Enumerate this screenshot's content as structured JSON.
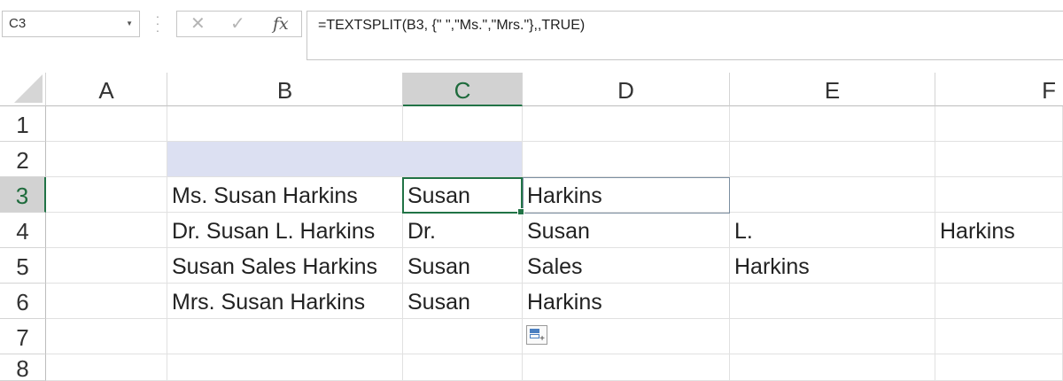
{
  "formula_bar": {
    "name_box": "C3",
    "cancel_glyph": "✕",
    "enter_glyph": "✓",
    "fx_glyph": "fx",
    "formula": "=TEXTSPLIT(B3, {\" \",\"Ms.\",\"Mrs.\"},,TRUE)"
  },
  "columns": [
    "A",
    "B",
    "C",
    "D",
    "E",
    "F"
  ],
  "rows": [
    "1",
    "2",
    "3",
    "4",
    "5",
    "6",
    "7",
    "8"
  ],
  "cells": {
    "B3": "Ms. Susan Harkins",
    "C3": "Susan",
    "D3": "Harkins",
    "B4": "Dr. Susan L. Harkins",
    "C4": "Dr.",
    "D4": "Susan",
    "E4": "L.",
    "F4": "Harkins",
    "B5": "Susan Sales Harkins",
    "C5": "Susan",
    "D5": "Sales",
    "E5": "Harkins",
    "B6": "Mrs. Susan Harkins",
    "C6": "Susan",
    "D6": "Harkins"
  },
  "selection": {
    "active_cell": "C3",
    "active_column": "C",
    "active_row": "3"
  },
  "colors": {
    "accent": "#217346",
    "shaded_range": "#dce0f2",
    "header_selected": "#d2d2d2"
  },
  "icons": {
    "quick_analysis": "quick-analysis-icon",
    "name_box_dropdown": "chevron-down-icon"
  }
}
